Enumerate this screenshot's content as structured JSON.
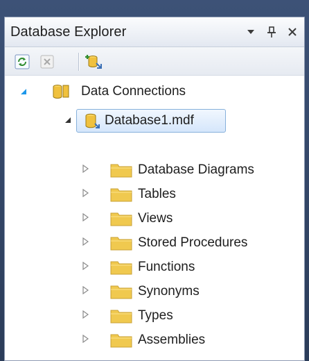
{
  "window": {
    "title": "Database Explorer"
  },
  "toolbar": {
    "refresh_icon": "refresh-icon",
    "stop_icon": "stop-icon",
    "connect_icon": "connect-to-database-icon"
  },
  "tree": {
    "root": {
      "label": "Data Connections",
      "icon": "data-connections-icon",
      "expanded": true
    },
    "database": {
      "label": "Database1.mdf",
      "icon": "database-icon",
      "expanded": true,
      "selected": true
    },
    "folders": [
      {
        "label": "Database Diagrams"
      },
      {
        "label": "Tables"
      },
      {
        "label": "Views"
      },
      {
        "label": "Stored Procedures"
      },
      {
        "label": "Functions"
      },
      {
        "label": "Synonyms"
      },
      {
        "label": "Types"
      },
      {
        "label": "Assemblies"
      }
    ]
  },
  "colors": {
    "folder": "#f0c94f",
    "selection_border": "#86b0db",
    "panel_border": "#8e9bb3"
  }
}
